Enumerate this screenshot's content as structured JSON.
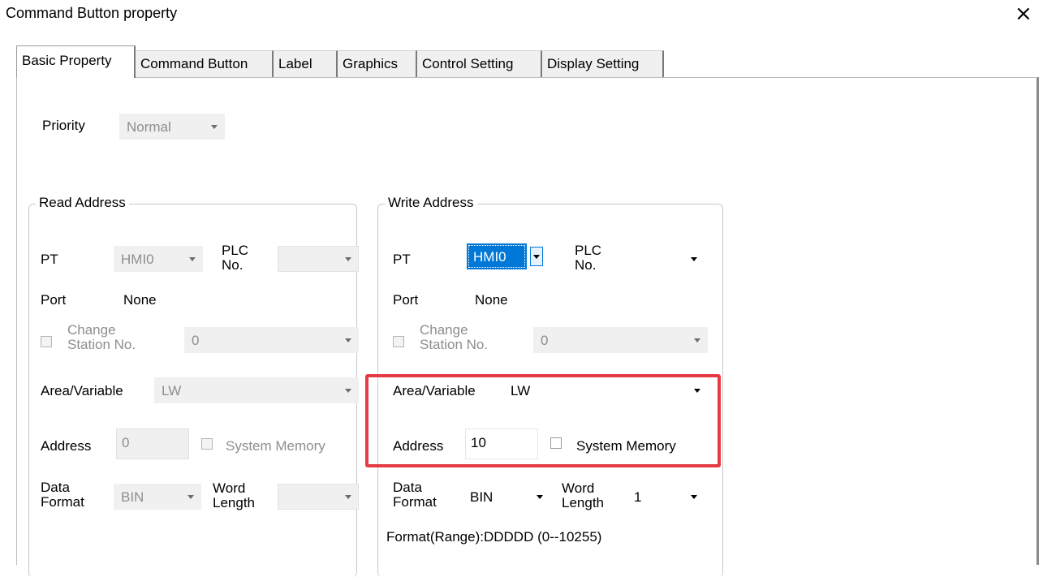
{
  "window": {
    "title": "Command Button property",
    "close_glyph": "×"
  },
  "tabs": [
    {
      "label": "Basic Property",
      "active": true
    },
    {
      "label": "Command Button",
      "active": false
    },
    {
      "label": "Label",
      "active": false
    },
    {
      "label": "Graphics",
      "active": false
    },
    {
      "label": "Control Setting",
      "active": false
    },
    {
      "label": "Display Setting",
      "active": false
    }
  ],
  "priority": {
    "label": "Priority",
    "value": "Normal"
  },
  "read_address": {
    "legend": "Read Address",
    "pt_label": "PT",
    "pt_value": "HMI0",
    "plc_label_1": "PLC",
    "plc_label_2": "No.",
    "plc_value": "",
    "port_label": "Port",
    "port_value": "None",
    "change_station_label_1": "Change",
    "change_station_label_2": "Station No.",
    "change_station_value": "0",
    "area_label": "Area/Variable",
    "area_value": "LW",
    "address_label": "Address",
    "address_value": "0",
    "system_memory_label": "System Memory",
    "data_format_label_1": "Data",
    "data_format_label_2": "Format",
    "data_format_value": "BIN",
    "word_length_label_1": "Word",
    "word_length_label_2": "Length",
    "word_length_value": ""
  },
  "write_address": {
    "legend": "Write Address",
    "pt_label": "PT",
    "pt_value": "HMI0",
    "plc_label_1": "PLC",
    "plc_label_2": "No.",
    "plc_value": "",
    "port_label": "Port",
    "port_value": "None",
    "change_station_label_1": "Change",
    "change_station_label_2": "Station No.",
    "change_station_value": "0",
    "area_label": "Area/Variable",
    "area_value": "LW",
    "address_label": "Address",
    "address_value": "10",
    "system_memory_label": "System Memory",
    "data_format_label_1": "Data",
    "data_format_label_2": "Format",
    "data_format_value": "BIN",
    "word_length_label_1": "Word",
    "word_length_label_2": "Length",
    "word_length_value": "1",
    "format_range": "Format(Range):DDDDD (0--10255)"
  },
  "colors": {
    "highlight": "#e53b44",
    "selection": "#0078d7",
    "disabled_text": "#8e8e8e"
  }
}
